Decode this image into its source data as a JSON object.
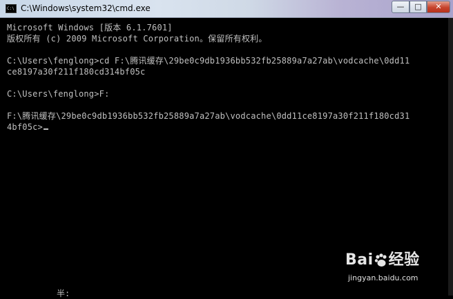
{
  "window": {
    "title": "C:\\Windows\\system32\\cmd.exe",
    "icon_label": "C:\\",
    "controls": {
      "minimize": "—",
      "maximize": "□",
      "close": "✕"
    }
  },
  "console": {
    "lines": [
      "Microsoft Windows [版本 6.1.7601]",
      "版权所有 (c) 2009 Microsoft Corporation。保留所有权利。",
      "",
      "C:\\Users\\fenglong>cd F:\\腾讯缓存\\29be0c9db1936bb532fb25889a7a27ab\\vodcache\\0dd11",
      "ce8197a30f211f180cd314bf05c",
      "",
      "C:\\Users\\fenglong>F:",
      "",
      "F:\\腾讯缓存\\29be0c9db1936bb532fb25889a7a27ab\\vodcache\\0dd11ce8197a30f211f180cd31",
      "4bf05c>"
    ],
    "partial_line": "半:"
  },
  "watermark": {
    "logo_prefix": "Bai",
    "logo_suffix": "经验",
    "url": "jingyan.baidu.com"
  }
}
